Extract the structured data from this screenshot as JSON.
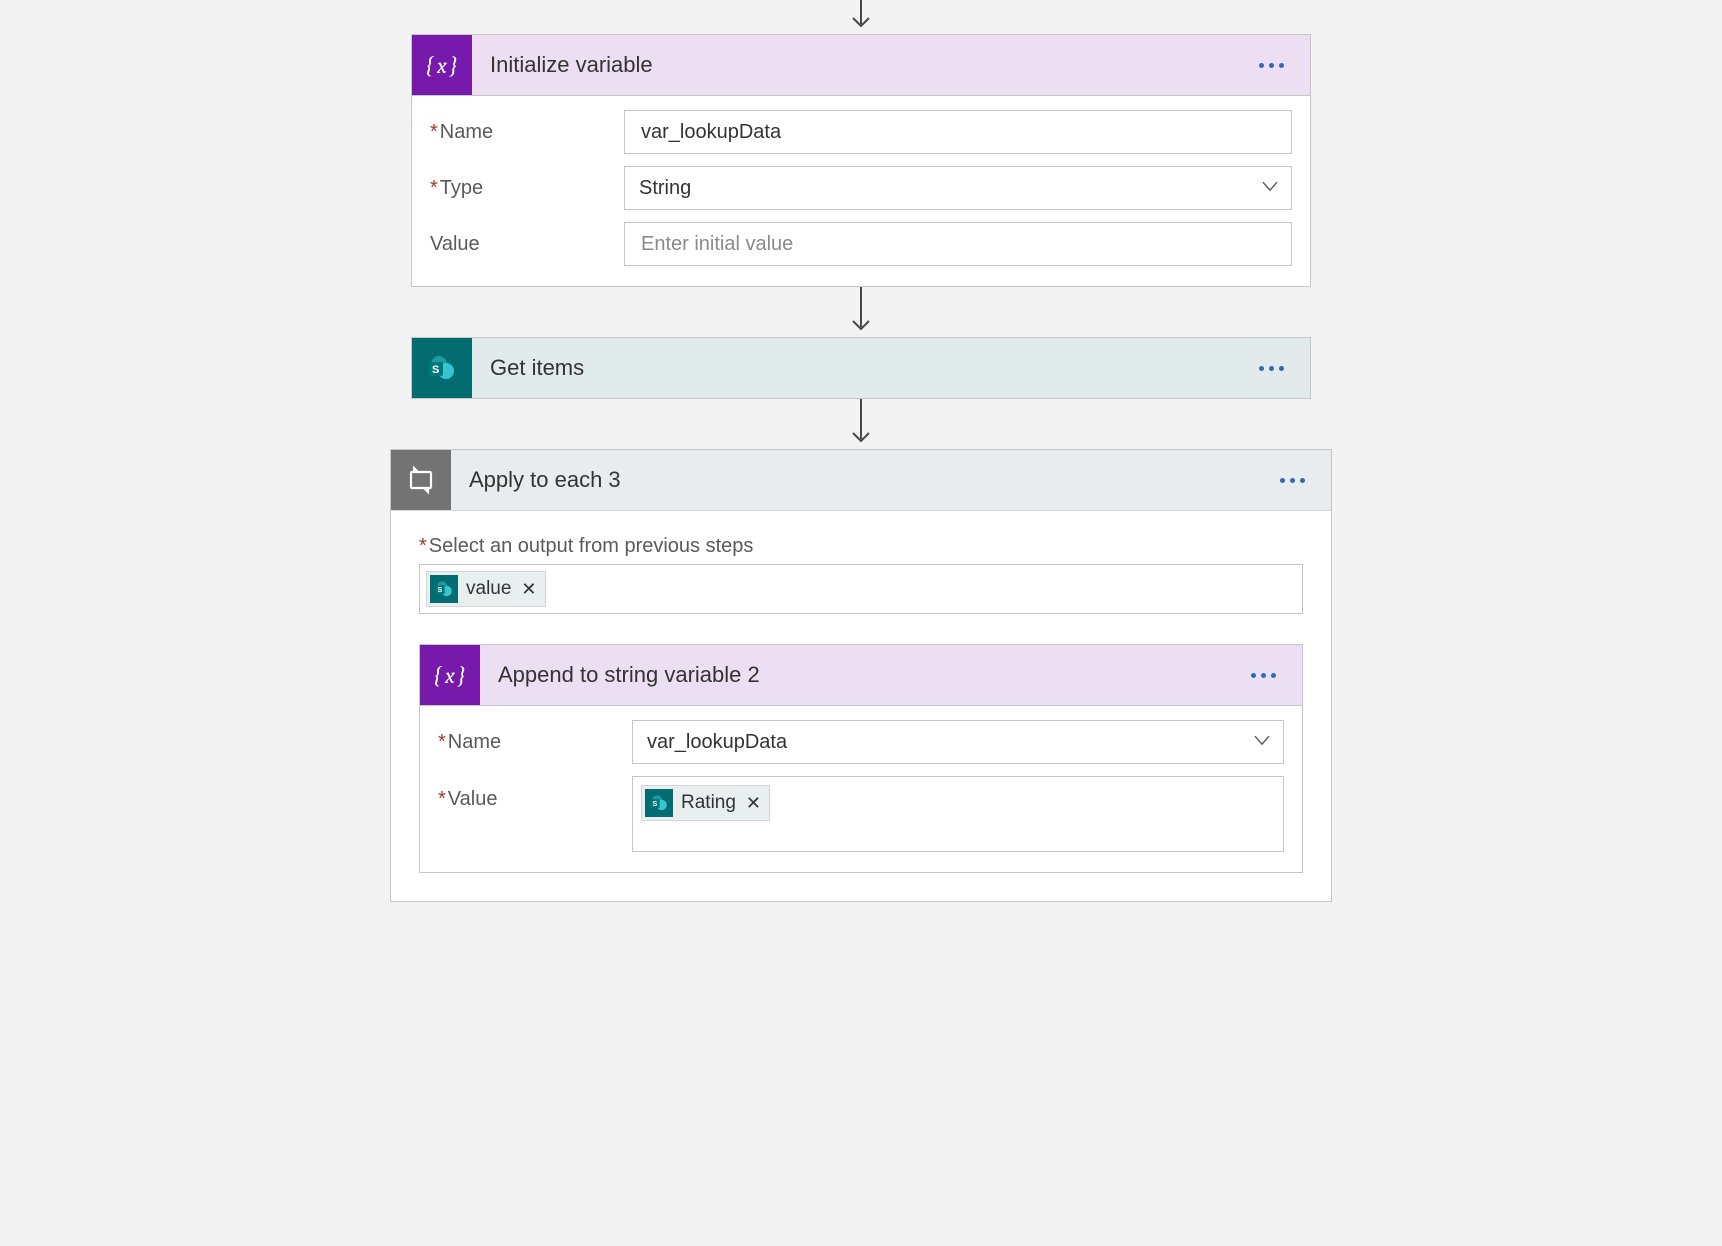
{
  "steps": {
    "initVar": {
      "title": "Initialize variable",
      "fields": {
        "nameLabel": "Name",
        "nameValue": "var_lookupData",
        "typeLabel": "Type",
        "typeValue": "String",
        "valueLabel": "Value",
        "valuePlaceholder": "Enter initial value"
      }
    },
    "getItems": {
      "title": "Get items"
    },
    "applyEach": {
      "title": "Apply to each 3",
      "selectLabel": "Select an output from previous steps",
      "token": "value"
    },
    "appendStr": {
      "title": "Append to string variable 2",
      "fields": {
        "nameLabel": "Name",
        "nameValue": "var_lookupData",
        "valueLabel": "Value",
        "token": "Rating"
      }
    }
  },
  "icons": {
    "variable": "{x}",
    "sharepoint": "sharepoint",
    "loop": "loop"
  },
  "colors": {
    "purpleHeader": "#ecdff4",
    "purpleIcon": "#7719aa",
    "tealHeader": "#e2ebeb",
    "tealIcon": "#036c70",
    "grayHeader": "#e9ecee",
    "grayIcon": "#737373"
  }
}
